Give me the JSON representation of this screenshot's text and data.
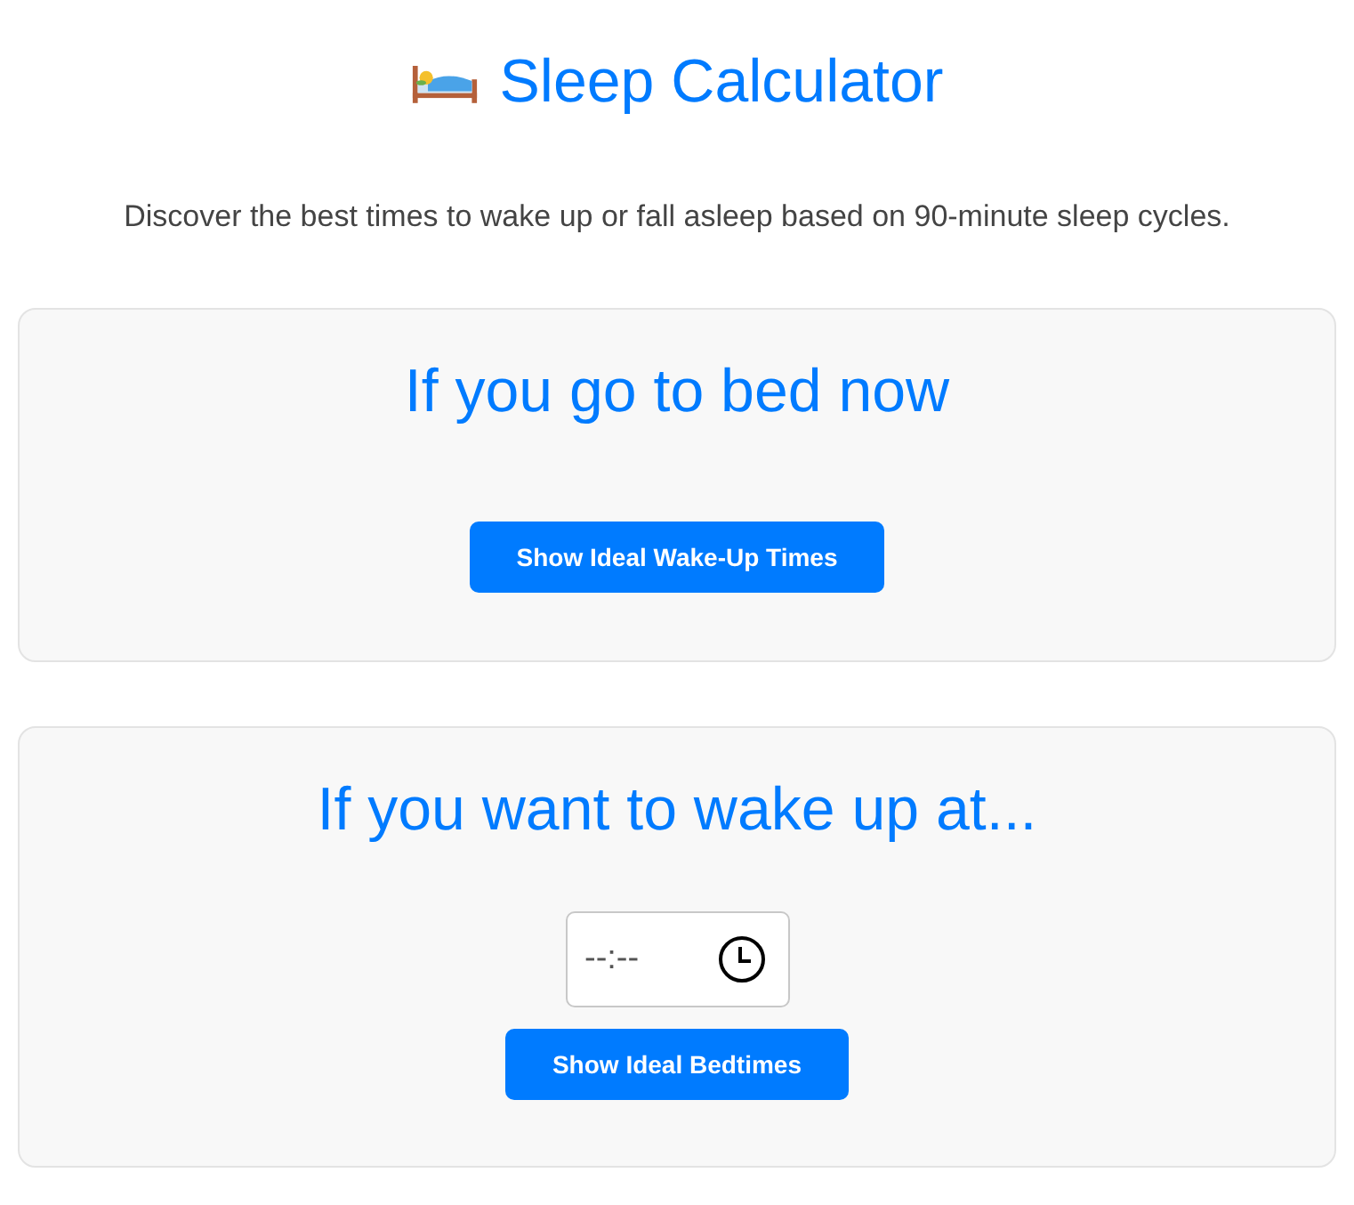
{
  "title": "Sleep Calculator",
  "subtitle": "Discover the best times to wake up or fall asleep based on 90-minute sleep cycles.",
  "cards": [
    {
      "kind": "now",
      "heading": "If you go to bed now",
      "button": "Show Ideal Wake-Up Times"
    },
    {
      "kind": "time",
      "heading": "If you want to wake up at...",
      "time_field": {
        "placeholder": "--:--"
      },
      "button": "Show Ideal Bedtimes"
    }
  ]
}
